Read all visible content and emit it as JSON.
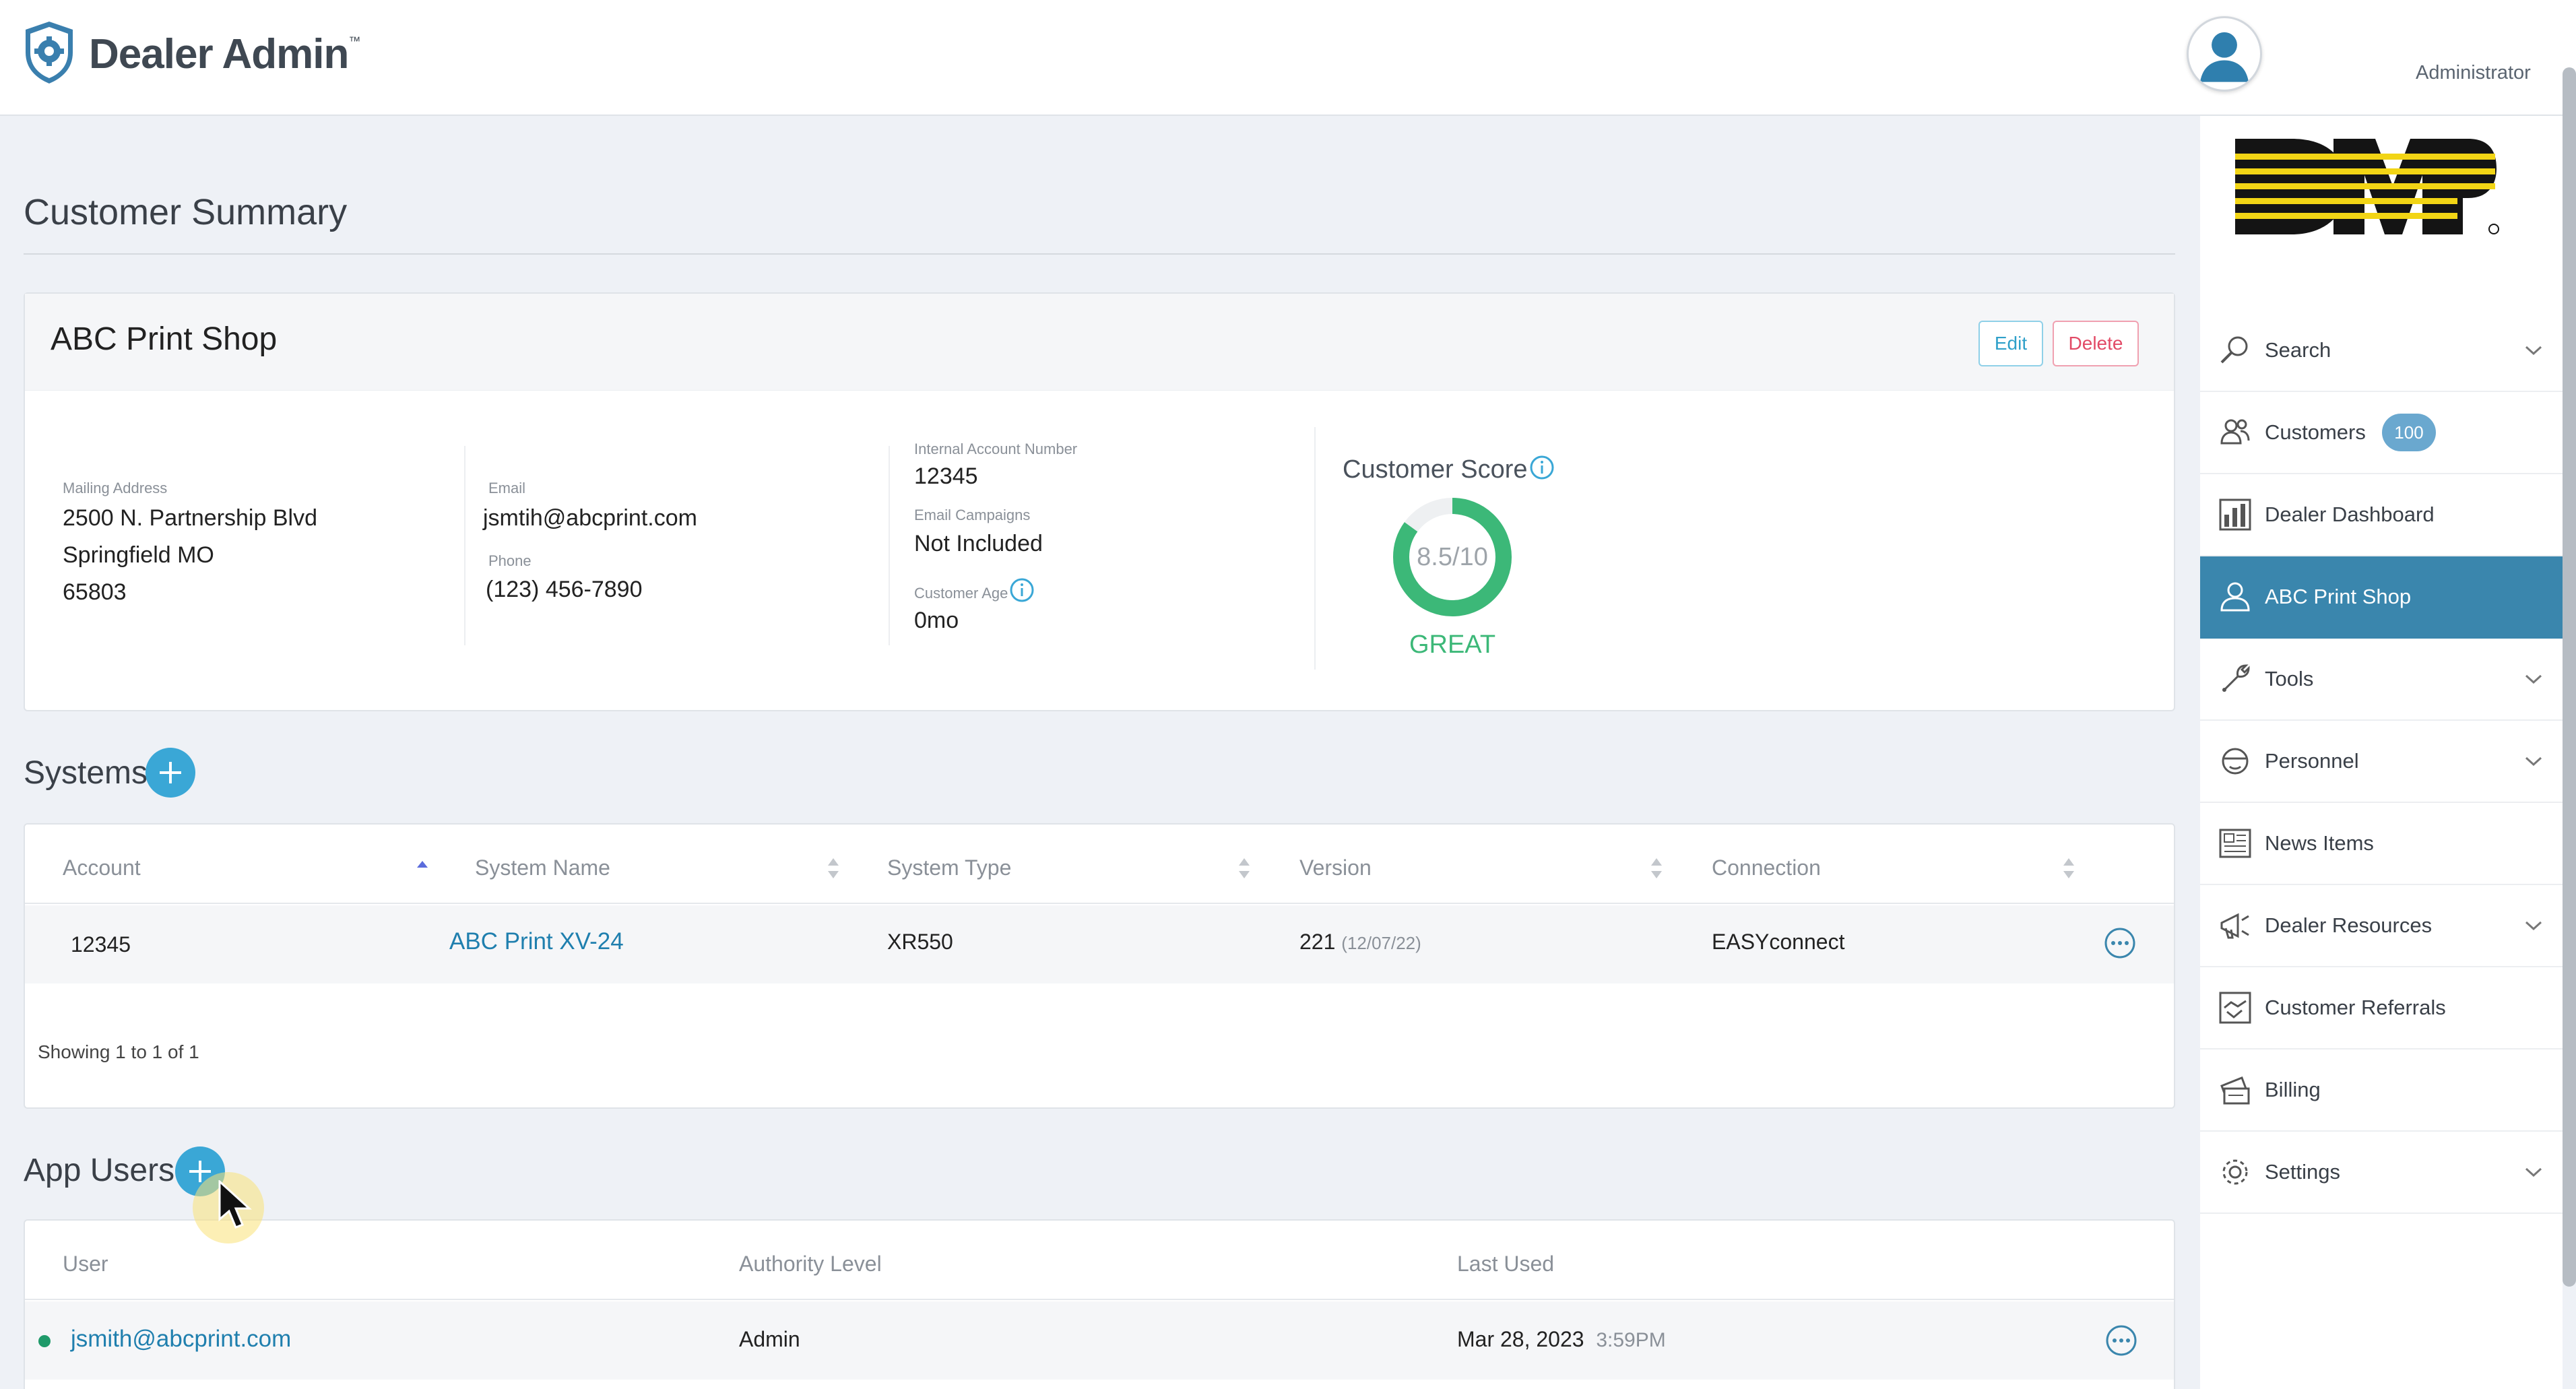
{
  "header": {
    "brand": "Dealer Admin",
    "brand_mark": "™",
    "user_role": "Administrator"
  },
  "colors": {
    "accent": "#3aa7d6",
    "active_nav": "#3a86ad",
    "link": "#1f7fae",
    "score_green": "#3cb878",
    "delete_red": "#e24a66"
  },
  "page": {
    "title": "Customer Summary"
  },
  "customer": {
    "name": "ABC Print Shop",
    "edit_label": "Edit",
    "delete_label": "Delete",
    "mailing_label": "Mailing Address",
    "address_line1": "2500 N. Partnership Blvd",
    "address_line2": "Springfield MO",
    "address_line3": "65803",
    "email_label": "Email",
    "email": "jsmtih@abcprint.com",
    "phone_label": "Phone",
    "phone": "(123) 456-7890",
    "account_number_label": "Internal Account Number",
    "account_number": "12345",
    "email_campaigns_label": "Email Campaigns",
    "email_campaigns": "Not Included",
    "customer_age_label": "Customer Age",
    "customer_age": "0mo",
    "score_title": "Customer Score",
    "score": "8.5/10",
    "score_value": 0.85,
    "score_grade": "GREAT"
  },
  "systems": {
    "title": "Systems",
    "columns": [
      "Account",
      "System Name",
      "System Type",
      "Version",
      "Connection"
    ],
    "rows": [
      {
        "account": "12345",
        "system_name": "ABC Print XV-24",
        "system_type": "XR550",
        "version": "221",
        "version_date": "(12/07/22)",
        "connection": "EASYconnect"
      }
    ],
    "showing": "Showing 1 to 1 of 1"
  },
  "app_users": {
    "title": "App Users",
    "columns": [
      "User",
      "Authority Level",
      "Last Used"
    ],
    "rows": [
      {
        "user": "jsmith@abcprint.com",
        "authority": "Admin",
        "last_used_date": "Mar 28, 2023",
        "last_used_time": "3:59PM"
      }
    ]
  },
  "sidebar": {
    "items": [
      {
        "label": "Search",
        "icon": "search-icon",
        "expandable": true
      },
      {
        "label": "Customers",
        "icon": "users-icon",
        "badge": "100"
      },
      {
        "label": "Dealer Dashboard",
        "icon": "dashboard-icon"
      },
      {
        "label": "ABC Print Shop",
        "icon": "user-icon",
        "active": true
      },
      {
        "label": "Tools",
        "icon": "wrench-icon",
        "expandable": true
      },
      {
        "label": "Personnel",
        "icon": "helmet-icon",
        "expandable": true
      },
      {
        "label": "News Items",
        "icon": "newspaper-icon"
      },
      {
        "label": "Dealer Resources",
        "icon": "megaphone-icon",
        "expandable": true
      },
      {
        "label": "Customer Referrals",
        "icon": "handshake-icon"
      },
      {
        "label": "Billing",
        "icon": "billing-icon"
      },
      {
        "label": "Settings",
        "icon": "gear-icon",
        "expandable": true
      }
    ]
  }
}
